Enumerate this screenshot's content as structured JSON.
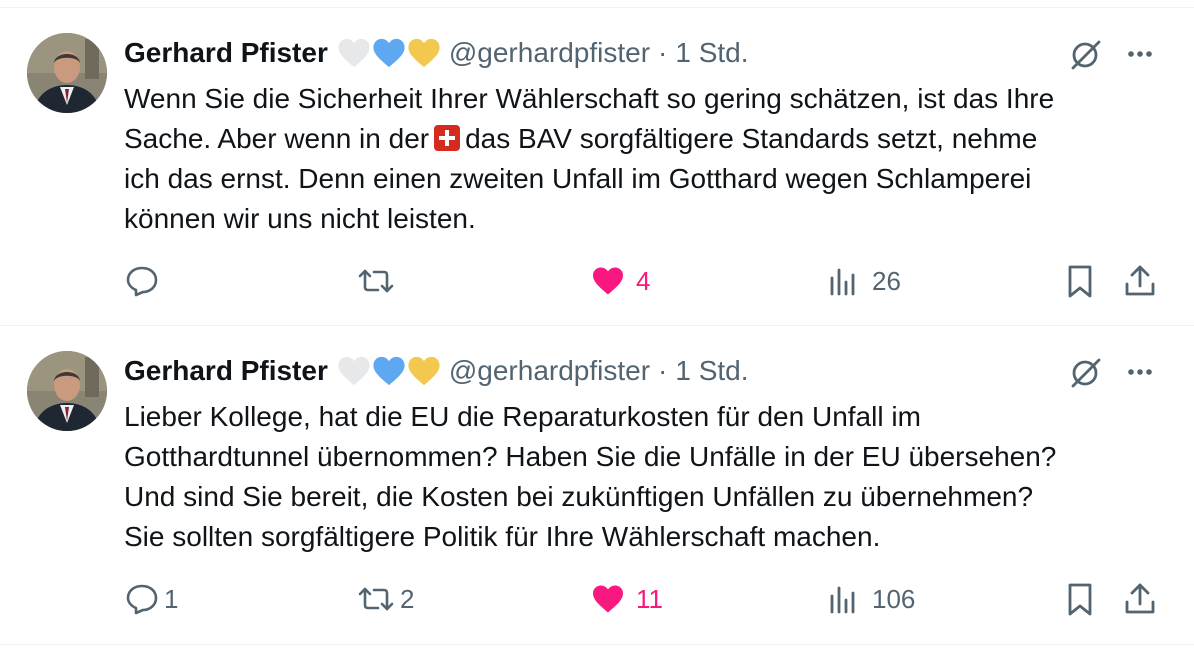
{
  "colors": {
    "text": "#0f1419",
    "secondary": "#536471",
    "like": "#f91880",
    "divider": "#eff3f4"
  },
  "tweets": [
    {
      "author": {
        "name": "Gerhard Pfister",
        "handle": "@gerhardpfister",
        "badges": [
          "white-heart-icon",
          "blue-heart-icon",
          "yellow-heart-icon"
        ]
      },
      "time": "1 Std.",
      "separator": "·",
      "text": {
        "line1": "Wenn Sie die Sicherheit Ihrer Wählerschaft so gering schätzen, ist das Ihre",
        "line2_before_flag": "Sache. Aber wenn in der",
        "flag_icon": "swiss-flag-icon",
        "line2_after_flag": "das BAV sorgfältigere Standards setzt, nehme",
        "line3": "ich das ernst. Denn einen zweiten Unfall im Gotthard wegen Schlamperei",
        "line4": "können wir uns nicht leisten."
      },
      "actions": {
        "replies": "",
        "reposts": "",
        "likes": "4",
        "views": "26",
        "liked": true
      }
    },
    {
      "author": {
        "name": "Gerhard Pfister",
        "handle": "@gerhardpfister",
        "badges": [
          "white-heart-icon",
          "blue-heart-icon",
          "yellow-heart-icon"
        ]
      },
      "time": "1 Std.",
      "separator": "·",
      "text": {
        "line1": "Lieber Kollege, hat die EU die Reparaturkosten für den Unfall im",
        "line2": "Gotthardtunnel übernommen? Haben Sie die Unfälle in der EU übersehen?",
        "line3": "Und sind Sie bereit, die Kosten bei zukünftigen Unfällen zu übernehmen?",
        "line4": "Sie sollten sorgfältigere Politik für Ihre Wählerschaft machen."
      },
      "actions": {
        "replies": "1",
        "reposts": "2",
        "likes": "11",
        "views": "106",
        "liked": true
      }
    }
  ]
}
